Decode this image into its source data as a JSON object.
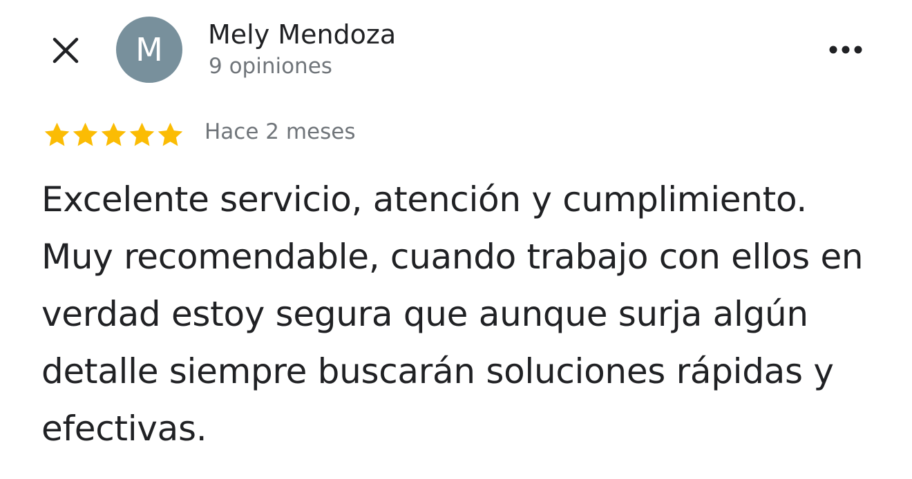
{
  "header": {
    "close_icon": "close-icon",
    "avatar_initial": "M",
    "avatar_color": "#78909c",
    "author_name": "Mely Mendoza",
    "review_count": "9 opiniones",
    "more_icon": "more-horizontal-icon"
  },
  "review": {
    "rating": 5,
    "rating_max": 5,
    "star_color": "#fbbc04",
    "date": "Hace 2 meses",
    "text": "Excelente servicio, atención y cumplimiento. Muy recomendable, cuando trabajo con ellos en verdad estoy segura que aunque surja algún detalle siempre buscarán soluciones rápidas y efectivas."
  }
}
